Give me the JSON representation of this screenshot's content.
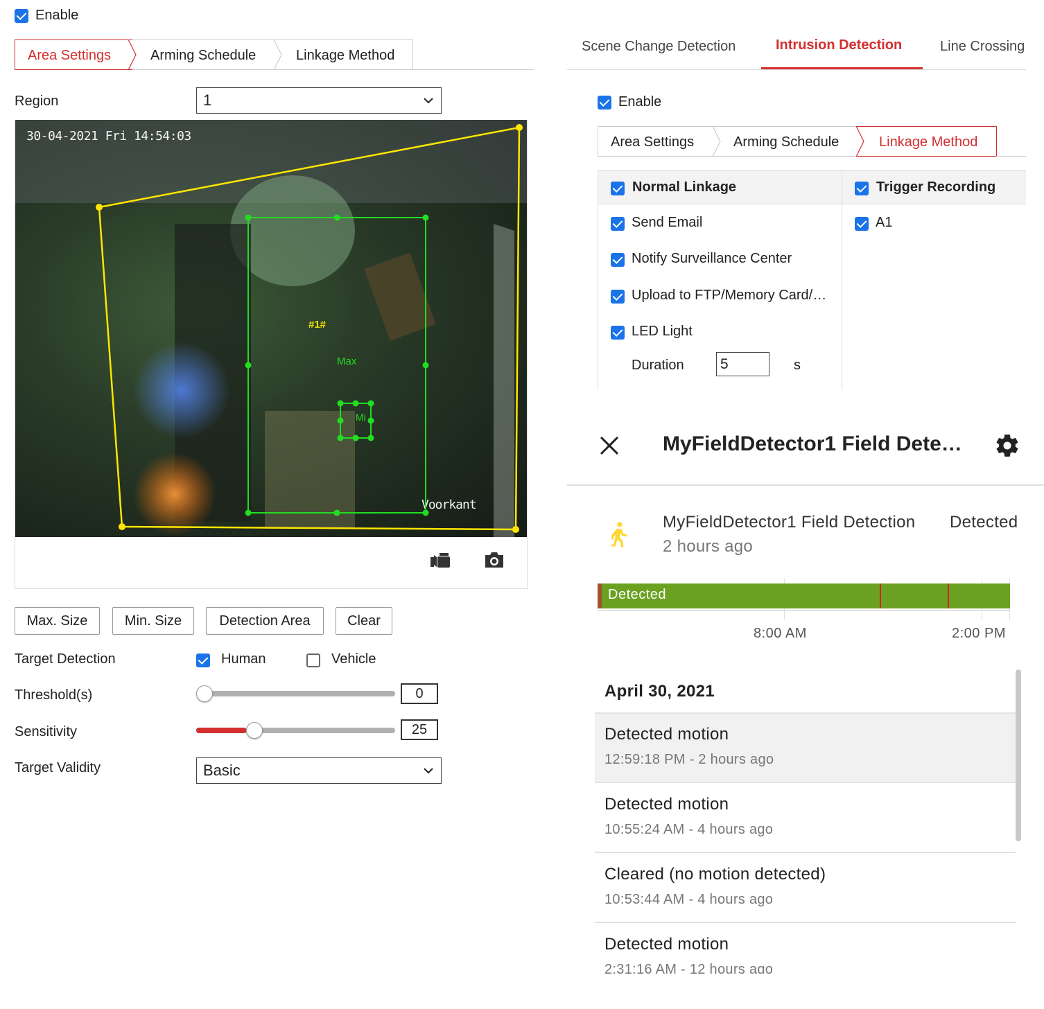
{
  "left": {
    "enable_label": "Enable",
    "enable_checked": true,
    "tabs": [
      {
        "label": "Area Settings",
        "active": true
      },
      {
        "label": "Arming Schedule",
        "active": false
      },
      {
        "label": "Linkage Method",
        "active": false
      }
    ],
    "region_label": "Region",
    "region_value": "1",
    "video": {
      "osd_timestamp": "30-04-2021 Fri 14:54:03",
      "osd_name": "Voorkant",
      "box_label_id": "#1#",
      "box_label_max": "Max",
      "box_label_min": "Mi",
      "record_icon": "video-record-icon",
      "snapshot_icon": "camera-icon"
    },
    "buttons": {
      "max_size": "Max. Size",
      "min_size": "Min. Size",
      "detection_area": "Detection Area",
      "clear": "Clear"
    },
    "target_detection_label": "Target Detection",
    "human_label": "Human",
    "human_checked": true,
    "vehicle_label": "Vehicle",
    "vehicle_checked": false,
    "threshold_label": "Threshold(s)",
    "threshold_value": "0",
    "threshold_fraction": 0.0,
    "sensitivity_label": "Sensitivity",
    "sensitivity_value": "25",
    "sensitivity_fraction": 0.25,
    "target_validity_label": "Target Validity",
    "target_validity_value": "Basic"
  },
  "right": {
    "tabs": [
      {
        "label": "Scene Change Detection",
        "active": false
      },
      {
        "label": "Intrusion Detection",
        "active": true
      },
      {
        "label": "Line Crossing",
        "active": false
      }
    ],
    "enable_label": "Enable",
    "enable_checked": true,
    "subtabs": [
      {
        "label": "Area Settings",
        "active": false
      },
      {
        "label": "Arming Schedule",
        "active": false
      },
      {
        "label": "Linkage Method",
        "active": true
      }
    ],
    "normal_linkage": {
      "header": "Normal Linkage",
      "items": [
        "Send Email",
        "Notify Surveillance Center",
        "Upload to FTP/Memory Card/…",
        "LED Light"
      ],
      "duration_label": "Duration",
      "duration_value": "5",
      "duration_unit": "s"
    },
    "trigger_recording": {
      "header": "Trigger Recording",
      "items": [
        "A1"
      ]
    }
  },
  "card": {
    "close_icon": "close-icon",
    "title": "MyFieldDetector1 Field Dete…",
    "settings_icon": "gear-icon",
    "entity_icon": "walking-person-icon",
    "entity_name": "MyFieldDetector1 Field Detection",
    "entity_state": "Detected",
    "entity_time": "2 hours ago",
    "timeline_label": "Detected",
    "timeline_ticks": [
      "8:00 AM",
      "2:00 PM"
    ],
    "timeline_color": "#6aa121",
    "date_header": "April 30, 2021",
    "log": [
      {
        "event": "Detected motion",
        "time": "12:59:18 PM - 2 hours ago"
      },
      {
        "event": "Detected motion",
        "time": "10:55:24 AM - 4 hours ago"
      },
      {
        "event": "Cleared (no motion detected)",
        "time": "10:53:44 AM - 4 hours ago"
      },
      {
        "event": "Detected motion",
        "time": "2:31:16 AM - 12 hours ago"
      }
    ]
  },
  "colors": {
    "accent_red": "#d32f2f",
    "checkbox_blue": "#1a73e8",
    "zone_yellow": "#ffe600",
    "box_green": "#22dd22"
  }
}
